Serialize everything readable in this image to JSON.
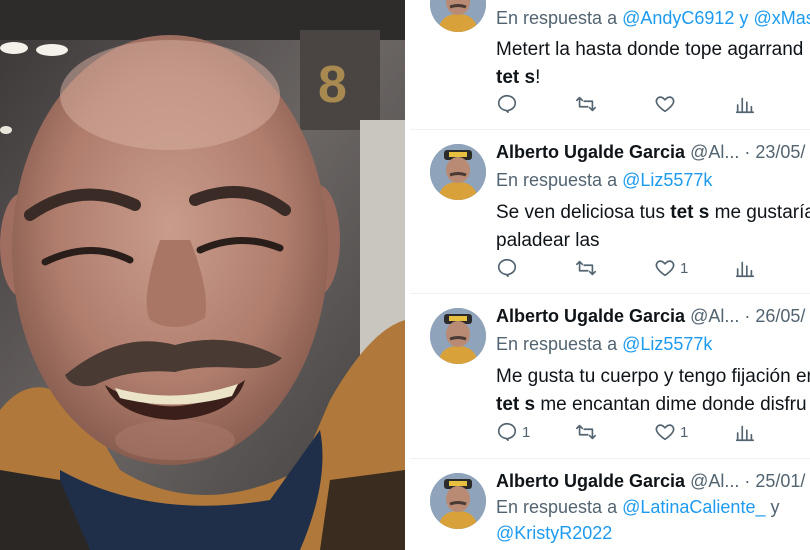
{
  "tweets": [
    {
      "name": "",
      "meta": "",
      "reply_prefix": "En respuesta a",
      "reply_mention": "@AndyC6912 y @xMas",
      "line1": "Metert  la hasta donde tope agarrand",
      "line2_bold": "tet  s",
      "line2_rest": "!",
      "reply_count": "",
      "retweet_count": "",
      "like_count": ""
    },
    {
      "name": "Alberto Ugalde Garcia",
      "meta": "@Al... · 23/05/",
      "reply_prefix": "En respuesta a",
      "reply_mention": "@Liz5577k",
      "line1_pre": "Se ven deliciosa tus ",
      "line1_bold": "tet  s",
      "line1_post": " me gustaría",
      "line2": "paladear las",
      "reply_count": "",
      "retweet_count": "",
      "like_count": "1"
    },
    {
      "name": "Alberto Ugalde Garcia",
      "meta": "@Al... · 26/05/",
      "reply_prefix": "En respuesta a",
      "reply_mention": "@Liz5577k",
      "line1": "Me gusta tu cuerpo y tengo fijación en",
      "line2_bold": "tet  s",
      "line2_rest": " me encantan dime donde disfru",
      "reply_count": "1",
      "retweet_count": "",
      "like_count": "1"
    },
    {
      "name": "Alberto Ugalde Garcia",
      "meta": "@Al... · 25/01/",
      "reply_prefix": "En respuesta a",
      "reply_mention": "@LatinaCaliente_",
      "reply_join": " y",
      "reply_mention2": "@KristyR2022"
    }
  ],
  "photo": {
    "sign_text": "8"
  },
  "icons": {
    "reply": "reply-icon",
    "retweet": "retweet-icon",
    "like": "heart-icon",
    "views": "views-icon"
  },
  "colors": {
    "link": "#1d9bf0",
    "secondary": "#536471",
    "text": "#0f1419"
  }
}
